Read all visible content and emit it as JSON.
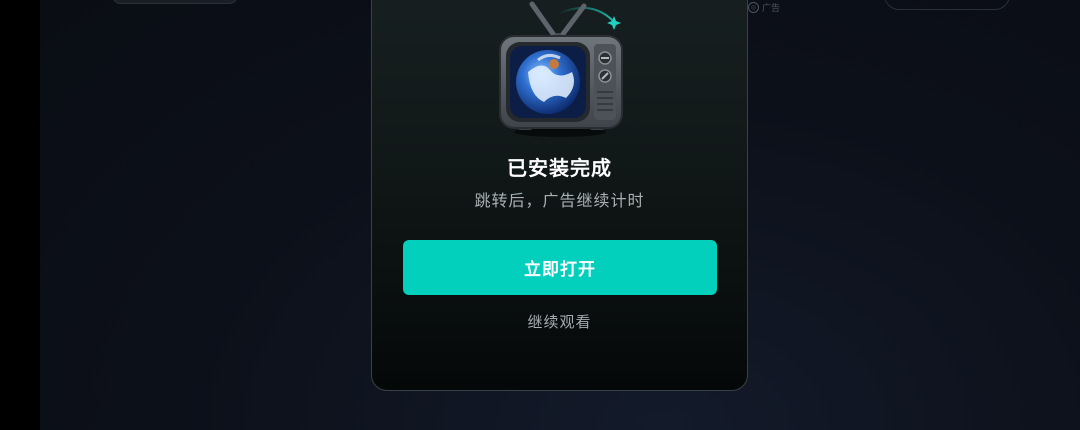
{
  "background": {
    "ad_label": "广告"
  },
  "modal": {
    "title": "已安装完成",
    "subtitle": "跳转后，广告继续计时",
    "primary_button_label": "立即打开",
    "secondary_link_label": "继续观看",
    "accent_color": "#03CFBD"
  },
  "icons": {
    "illustration": "retro-tv-icon",
    "sparkle": "sparkle-icon",
    "ad_badge": "ad-badge-icon"
  }
}
